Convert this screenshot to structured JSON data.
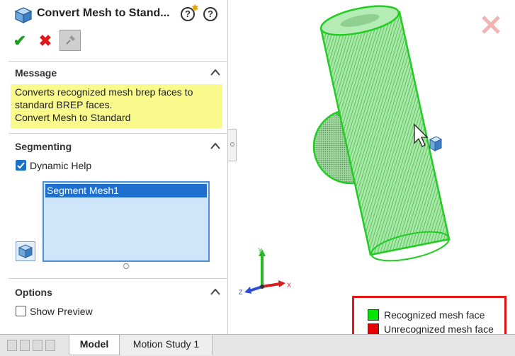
{
  "title_bar": {
    "title": "Convert Mesh to Stand...",
    "icons": [
      "mesh-cube-icon",
      "whats-new-icon",
      "help-icon"
    ]
  },
  "actions": {
    "ok_icon": "check-icon",
    "cancel_icon": "close-icon",
    "pin_icon": "pin-icon"
  },
  "message": {
    "title": "Message",
    "lines": [
      "Converts recognized mesh brep faces to",
      "standard BREP faces.",
      "Convert Mesh to Standard"
    ]
  },
  "segmenting": {
    "title": "Segmenting",
    "dynamic_help_label": "Dynamic Help",
    "dynamic_help_checked": true,
    "list_items": [
      "Segment Mesh1"
    ]
  },
  "options": {
    "title": "Options",
    "show_preview_label": "Show Preview",
    "show_preview_checked": false
  },
  "tabs": {
    "model": "Model",
    "motion_study": "Motion Study 1",
    "active": "Model"
  },
  "triad": {
    "x": "X",
    "y": "Y",
    "z": "Z"
  },
  "legend": {
    "items": [
      {
        "label": "Recognized mesh face",
        "color": "#00e600"
      },
      {
        "label": "Unrecognized mesh face",
        "color": "#e60000"
      }
    ]
  },
  "colors": {
    "accent": "#1f6fd0",
    "message_bg": "#f9f98c",
    "mesh_green": "#3cd93c",
    "legend_border": "#e01818"
  }
}
